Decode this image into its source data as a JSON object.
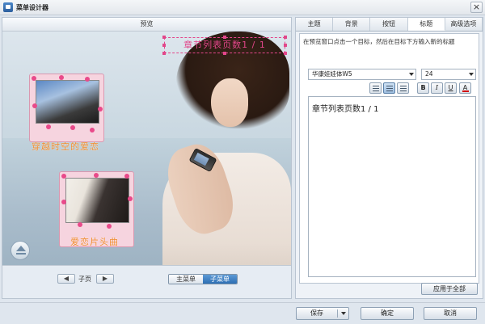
{
  "window": {
    "title": "菜单设计器",
    "close_label": "×"
  },
  "preview": {
    "header": "预览",
    "title_text": "章节列表页数1 / 1",
    "thumbnails": [
      {
        "label": "穿越时空的爱恋"
      },
      {
        "label": "爱恋片头曲"
      }
    ],
    "footer": {
      "prev_label": "◀",
      "next_label": "▶",
      "subpage_label": "子页",
      "main_menu_label": "主菜单",
      "sub_menu_label": "子菜单",
      "active_menu": "子菜单"
    }
  },
  "tabs": [
    {
      "label": "主题"
    },
    {
      "label": "背景"
    },
    {
      "label": "按钮"
    },
    {
      "label": "标题",
      "active": true
    },
    {
      "label": "高级选项"
    }
  ],
  "title_panel": {
    "hint": "在预览窗口点击一个目标，然后在目标下方输入新的标题",
    "font": "华康娃娃体W5",
    "size": "24",
    "format_buttons": {
      "bold": "B",
      "italic": "I",
      "underline": "U",
      "color": "A"
    },
    "text_value": "章节列表页数1 / 1",
    "apply_all_label": "应用于全部"
  },
  "bottom": {
    "save_label": "保存",
    "ok_label": "确定",
    "cancel_label": "取消"
  },
  "colors": {
    "accent": "#e2468a",
    "label_orange": "#f08a2c",
    "active_tab": "#ffffff",
    "submenu_active": "#2e6fb3"
  }
}
